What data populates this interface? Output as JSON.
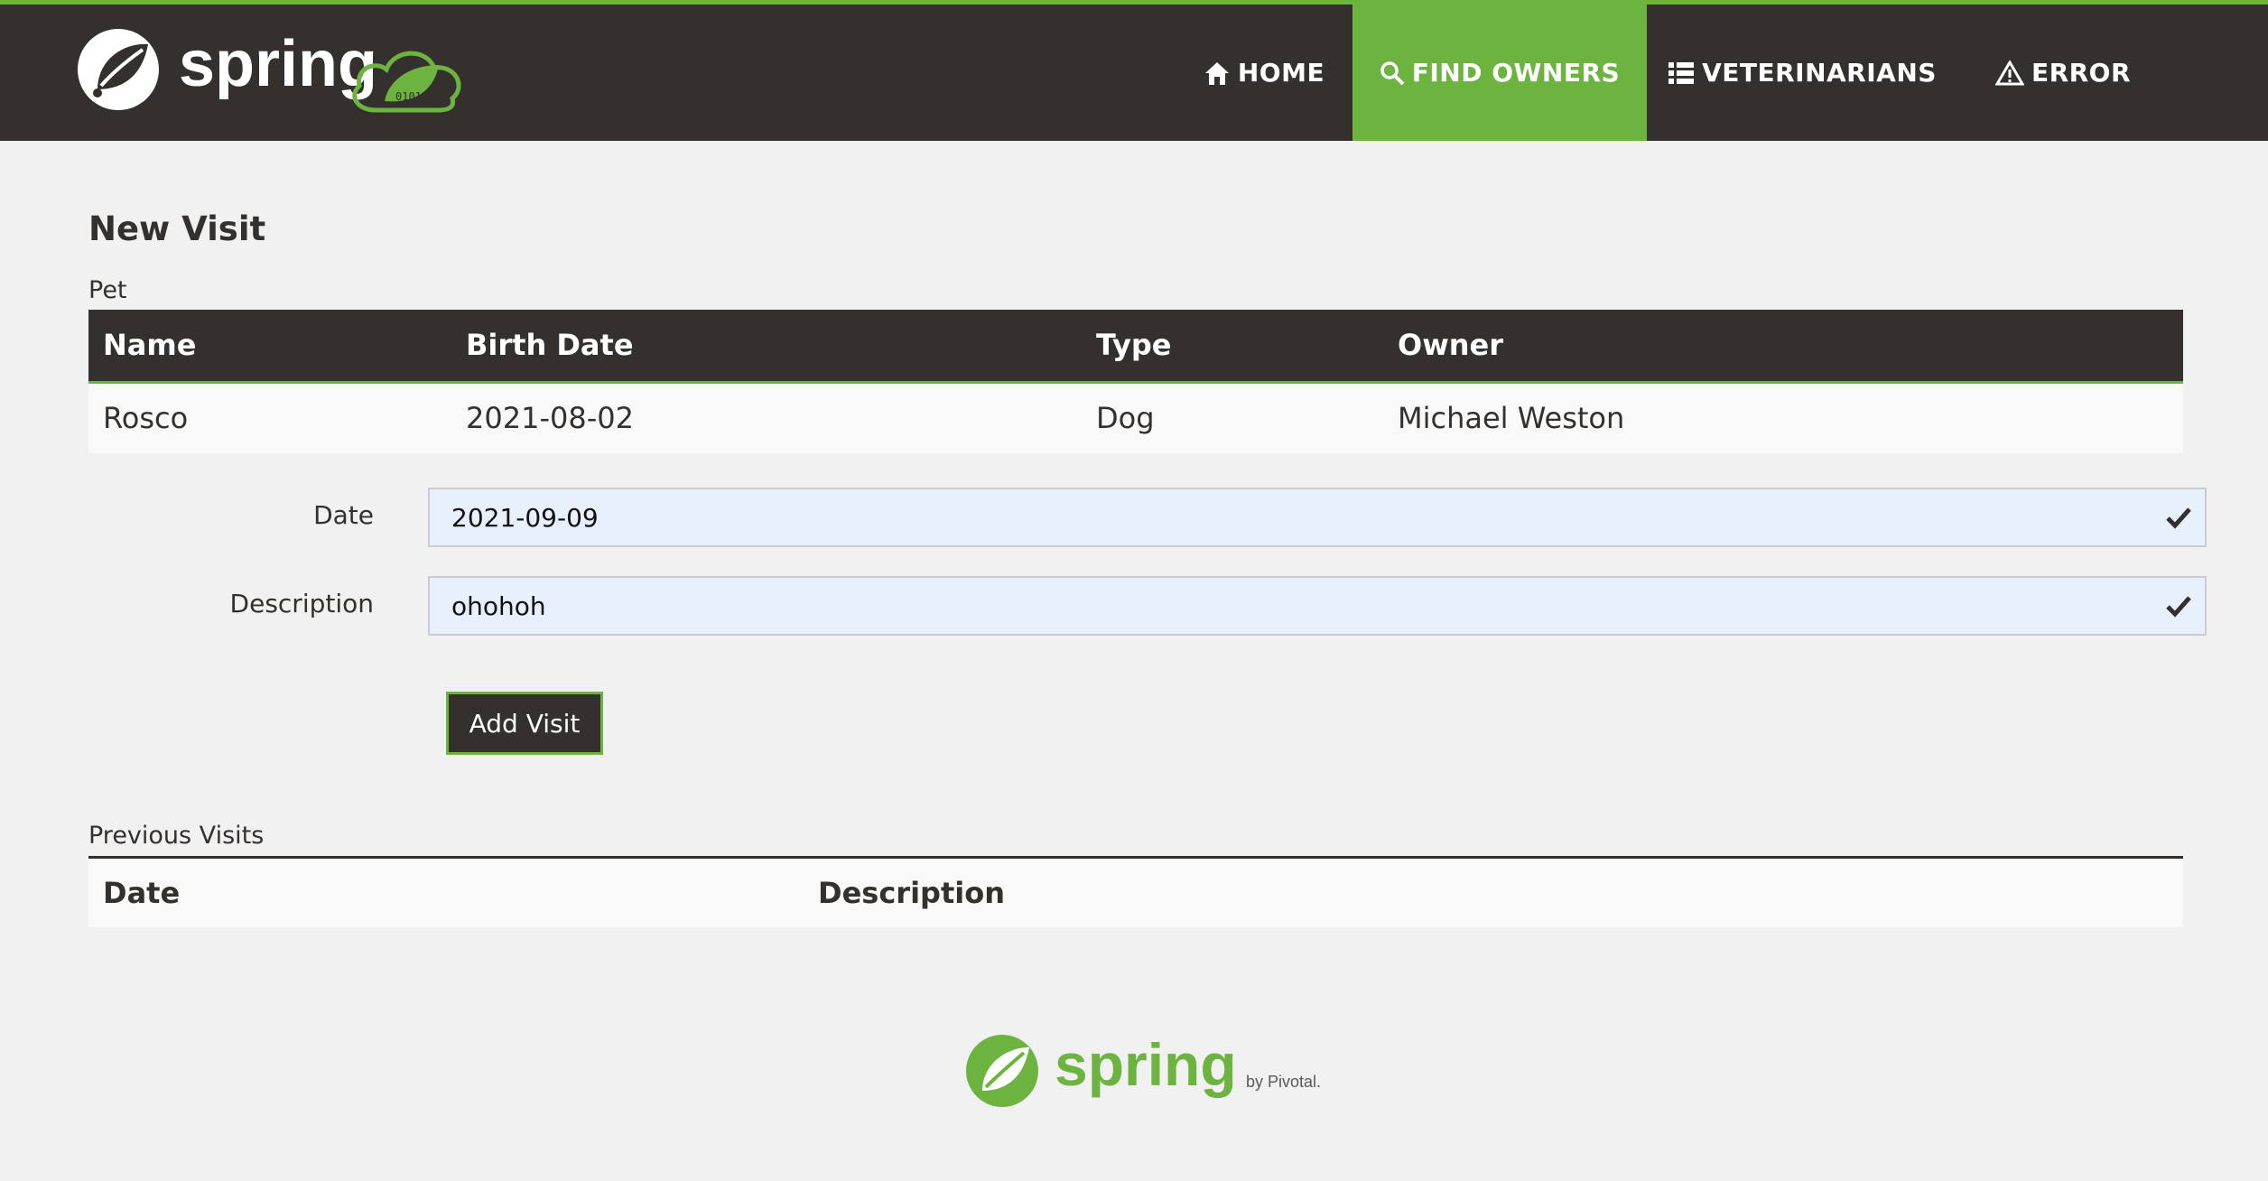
{
  "nav": {
    "brand": "spring",
    "items": [
      {
        "label": "HOME",
        "icon": "home-icon"
      },
      {
        "label": "FIND OWNERS",
        "icon": "search-icon",
        "active": true
      },
      {
        "label": "VETERINARIANS",
        "icon": "list-icon"
      },
      {
        "label": "ERROR",
        "icon": "warning-icon"
      }
    ]
  },
  "colors": {
    "brand_green": "#6db33f",
    "dark": "#34302d",
    "background": "#f1f1f1"
  },
  "page": {
    "title": "New Visit"
  },
  "pet": {
    "label": "Pet",
    "headers": [
      "Name",
      "Birth Date",
      "Type",
      "Owner"
    ],
    "row": [
      "Rosco",
      "2021-08-02",
      "Dog",
      "Michael Weston"
    ]
  },
  "form": {
    "date_label": "Date",
    "date_value": "2021-09-09",
    "description_label": "Description",
    "description_value": "ohohoh",
    "submit_label": "Add Visit"
  },
  "previous_visits": {
    "label": "Previous Visits",
    "headers": [
      "Date",
      "Description"
    ]
  },
  "footer": {
    "brand": "spring",
    "byline": "by Pivotal."
  }
}
